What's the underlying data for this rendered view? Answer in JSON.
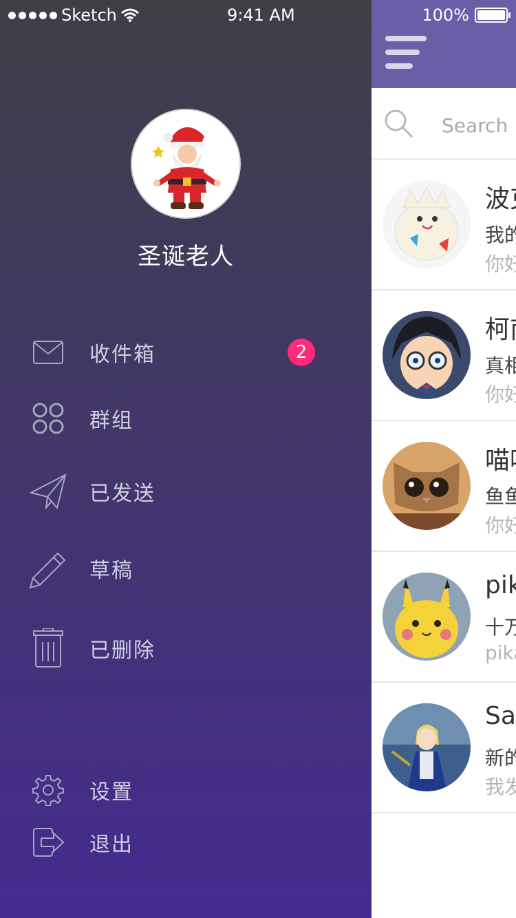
{
  "status_bar": {
    "carrier": "Sketch",
    "time": "9:41 AM",
    "battery": "100%"
  },
  "profile": {
    "name": "圣诞老人"
  },
  "menu": {
    "inbox": {
      "label": "收件箱",
      "badge": "2"
    },
    "groups": {
      "label": "群组"
    },
    "sent": {
      "label": "已发送"
    },
    "drafts": {
      "label": "草稿"
    },
    "deleted": {
      "label": "已删除"
    },
    "settings": {
      "label": "设置"
    },
    "logout": {
      "label": "退出"
    }
  },
  "search": {
    "placeholder": "Search"
  },
  "conversations": [
    {
      "name": "波克",
      "message": "我的",
      "preview": "你好"
    },
    {
      "name": "柯南",
      "message": "真相",
      "preview": "你好"
    },
    {
      "name": "喵喵",
      "message": "鱼鱼",
      "preview": "你好"
    },
    {
      "name": "pika",
      "message": "十万",
      "preview": "pika"
    },
    {
      "name": "Saber",
      "message": "新的",
      "preview": "我发"
    }
  ],
  "colors": {
    "accent_bar": "#6a5fa6",
    "badge": "#ff2a7a",
    "drawer_top": "#3f3f46",
    "drawer_bottom": "#452b8f"
  }
}
